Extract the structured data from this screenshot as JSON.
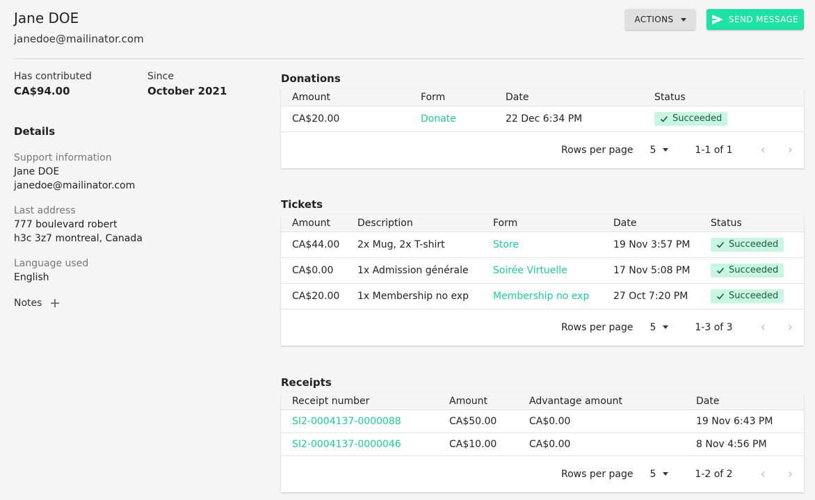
{
  "header": {
    "name": "Jane DOE",
    "email": "janedoe@mailinator.com",
    "actions_label": "ACTIONS",
    "send_label": "SEND MESSAGE"
  },
  "stats": {
    "contributed_label": "Has contributed",
    "contributed_value": "CA$94.00",
    "since_label": "Since",
    "since_value": "October 2021"
  },
  "details": {
    "title": "Details",
    "support_label": "Support information",
    "support_name": "Jane DOE",
    "support_email": "janedoe@mailinator.com",
    "address_label": "Last address",
    "address_line1": "777 boulevard robert",
    "address_line2": "h3c 3z7 montreal, Canada",
    "language_label": "Language used",
    "language_value": "English",
    "notes_label": "Notes"
  },
  "donations": {
    "title": "Donations",
    "columns": [
      "Amount",
      "Form",
      "Date",
      "Status"
    ],
    "rows": [
      {
        "amount": "CA$20.00",
        "form": "Donate",
        "date": "22 Dec 6:34 PM",
        "status": "Succeeded"
      }
    ],
    "rows_per_page_label": "Rows per page",
    "rows_per_page": "5",
    "range": "1-1 of 1"
  },
  "tickets": {
    "title": "Tickets",
    "columns": [
      "Amount",
      "Description",
      "Form",
      "Date",
      "Status"
    ],
    "rows": [
      {
        "amount": "CA$44.00",
        "description": "2x Mug, 2x T-shirt",
        "form": "Store",
        "date": "19 Nov 3:57 PM",
        "status": "Succeeded"
      },
      {
        "amount": "CA$0.00",
        "description": "1x Admission générale",
        "form": "Soirée Virtuelle",
        "date": "17 Nov 5:08 PM",
        "status": "Succeeded"
      },
      {
        "amount": "CA$20.00",
        "description": "1x Membership no exp",
        "form": "Membership no exp",
        "date": "27 Oct 7:20 PM",
        "status": "Succeeded"
      }
    ],
    "rows_per_page_label": "Rows per page",
    "rows_per_page": "5",
    "range": "1-3 of 3"
  },
  "receipts": {
    "title": "Receipts",
    "columns": [
      "Receipt number",
      "Amount",
      "Advantage amount",
      "Date"
    ],
    "rows": [
      {
        "number": "SI2-0004137-0000088",
        "amount": "CA$50.00",
        "advantage": "CA$0.00",
        "date": "19 Nov 6:43 PM"
      },
      {
        "number": "SI2-0004137-0000046",
        "amount": "CA$10.00",
        "advantage": "CA$0.00",
        "date": "8 Nov 4:56 PM"
      }
    ],
    "rows_per_page_label": "Rows per page",
    "rows_per_page": "5",
    "range": "1-2 of 2"
  },
  "colors": {
    "accent": "#1de2a2",
    "link": "#1dcf90",
    "badge_bg": "#c9f5e3"
  },
  "icons": {
    "send": "send-icon",
    "caret": "caret-down-icon",
    "plus": "plus-icon",
    "check": "check-icon",
    "prev": "chevron-left-icon",
    "next": "chevron-right-icon"
  }
}
